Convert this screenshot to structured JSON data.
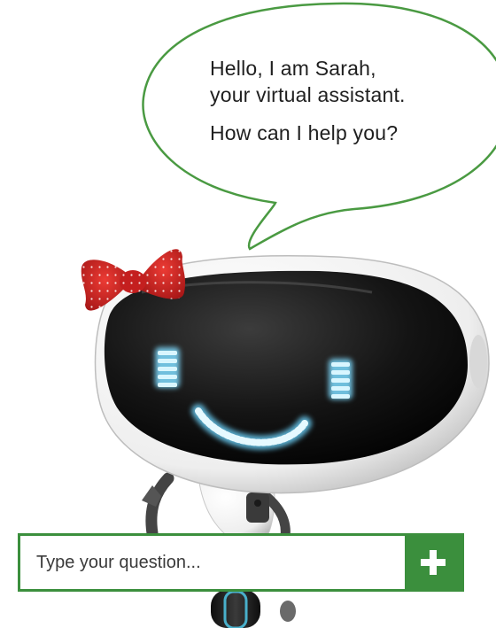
{
  "assistant": {
    "greeting_line1": "Hello, I am Sarah,",
    "greeting_line2": "your virtual assistant.",
    "question": "How can I help you?"
  },
  "chat": {
    "placeholder": "Type your question...",
    "send_icon": "plus-icon"
  },
  "colors": {
    "accent_green": "#3b8f3d",
    "bow_red": "#d42a2a",
    "eye_glow": "#bfefff"
  }
}
